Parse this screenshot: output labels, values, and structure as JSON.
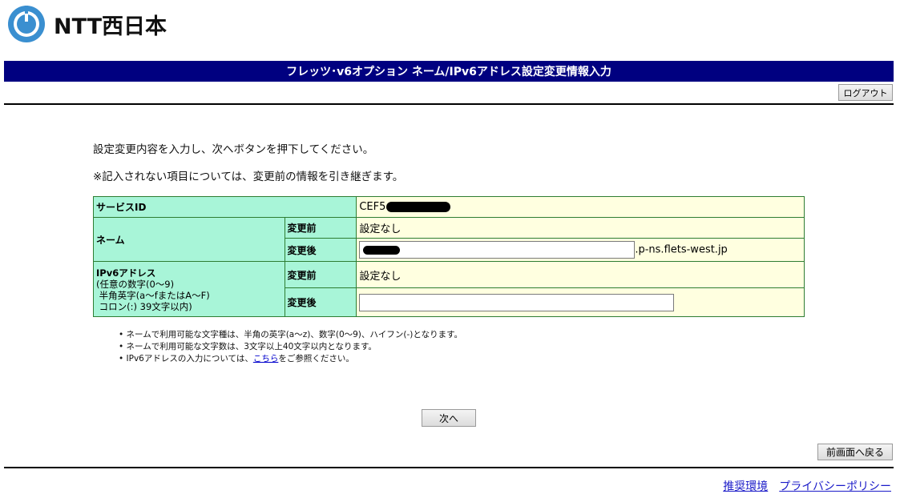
{
  "header": {
    "brand": "NTT西日本",
    "title": "フレッツ･v6オプション ネーム/IPv6アドレス設定変更情報入力",
    "logout_label": "ログアウト"
  },
  "instructions": {
    "line1": "設定変更内容を入力し、次へボタンを押下してください。",
    "line2": "※記入されない項目については、変更前の情報を引き継ぎます。"
  },
  "form": {
    "service_id": {
      "label": "サービスID",
      "value_prefix": "CEF5"
    },
    "name": {
      "label": "ネーム",
      "before_label": "変更前",
      "before_value": "設定なし",
      "after_label": "変更後",
      "suffix": ".p-ns.flets-west.jp"
    },
    "ipv6": {
      "label": "IPv6アドレス",
      "hint1": "(任意の数字(0～9)",
      "hint2": "半角英字(a～fまたはA～F)",
      "hint3": "コロン(:) 39文字以内)",
      "before_label": "変更前",
      "before_value": "設定なし",
      "after_label": "変更後"
    }
  },
  "notes": {
    "item1": "ネームで利用可能な文字種は、半角の英字(a～z)、数字(0～9)、ハイフン(-)となります。",
    "item2": "ネームで利用可能な文字数は、3文字以上40文字以内となります。",
    "item3_before": "IPv6アドレスの入力については、",
    "item3_link": "こちら",
    "item3_after": "をご参照ください。"
  },
  "actions": {
    "next_label": "次へ",
    "back_label": "前画面へ戻る"
  },
  "footer": {
    "link1": "推奨環境",
    "link2": "プライバシーポリシー"
  },
  "colors": {
    "title_bar": "#000080",
    "label_cell": "#a8f5d8",
    "value_cell": "#ffffe0",
    "logo_blue": "#3a8fd0"
  }
}
